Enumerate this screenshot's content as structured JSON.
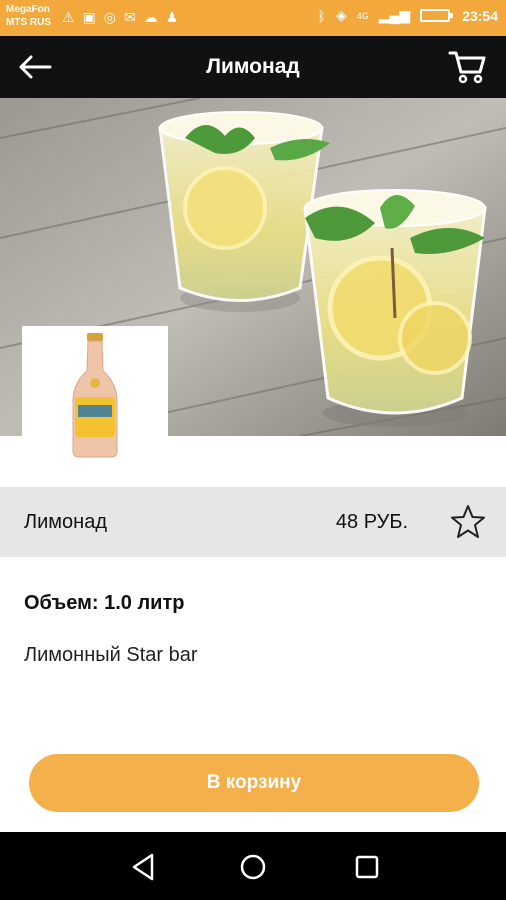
{
  "status_bar": {
    "carrier_1": "MegaFon",
    "carrier_2": "MTS RUS",
    "network_label": "4G",
    "time": "23:54",
    "background_color": "#f2a83b"
  },
  "toolbar": {
    "title": "Лимонад",
    "back_icon": "arrow-left-icon",
    "cart_icon": "cart-icon"
  },
  "product": {
    "name": "Лимонад",
    "price": "48 РУБ.",
    "volume": "Объем: 1.0 литр",
    "description": "Лимонный Star bar",
    "favorite_icon": "star-outline-icon"
  },
  "actions": {
    "add_to_cart_label": "В корзину",
    "accent_color": "#f4b04a"
  },
  "nav_bar": {
    "back_icon": "triangle-back-icon",
    "home_icon": "circle-home-icon",
    "recents_icon": "square-recents-icon"
  }
}
